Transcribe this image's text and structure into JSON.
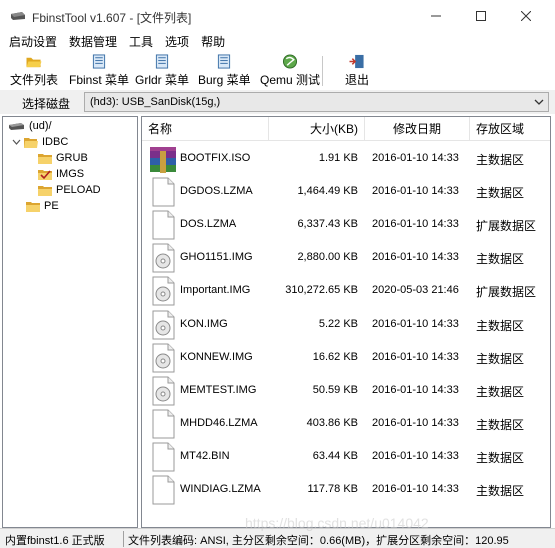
{
  "window": {
    "title": "FbinstTool v1.607 - [文件列表]"
  },
  "menu": [
    "启动设置",
    "数据管理",
    "工具",
    "选项",
    "帮助"
  ],
  "toolbar": {
    "buttons": [
      {
        "label": "文件列表",
        "icon": "folder-open-icon"
      },
      {
        "label": "Fbinst 菜单",
        "icon": "menu-doc-icon"
      },
      {
        "label": "Grldr 菜单",
        "icon": "menu-doc-icon"
      },
      {
        "label": "Burg 菜单",
        "icon": "menu-doc-icon"
      },
      {
        "label": "Qemu 测试",
        "icon": "qemu-globe-icon"
      },
      {
        "label": "退出",
        "icon": "exit-door-icon"
      }
    ]
  },
  "disk": {
    "label": "选择磁盘",
    "value": "(hd3): USB_SanDisk(15g,)"
  },
  "tree": {
    "root": "(ud)/",
    "nodes": [
      {
        "label": "IDBC"
      },
      {
        "label": "GRUB"
      },
      {
        "label": "IMGS"
      },
      {
        "label": "PELOAD"
      },
      {
        "label": "PE"
      }
    ]
  },
  "columns": {
    "name": "名称",
    "size": "大小(KB)",
    "date": "修改日期",
    "area": "存放区域"
  },
  "files": [
    {
      "name": "BOOTFIX.ISO",
      "size": "1.91 KB",
      "date": "2016-01-10 14:33",
      "area": "主数据区",
      "icon": "archive-icon"
    },
    {
      "name": "DGDOS.LZMA",
      "size": "1,464.49 KB",
      "date": "2016-01-10 14:33",
      "area": "主数据区",
      "icon": "blank-file-icon"
    },
    {
      "name": "DOS.LZMA",
      "size": "6,337.43 KB",
      "date": "2016-01-10 14:33",
      "area": "扩展数据区",
      "icon": "blank-file-icon"
    },
    {
      "name": "GHO1151.IMG",
      "size": "2,880.00 KB",
      "date": "2016-01-10 14:33",
      "area": "主数据区",
      "icon": "disk-image-icon"
    },
    {
      "name": "Important.IMG",
      "size": "310,272.65 KB",
      "date": "2020-05-03 21:46",
      "area": "扩展数据区",
      "icon": "disk-image-icon"
    },
    {
      "name": "KON.IMG",
      "size": "5.22 KB",
      "date": "2016-01-10 14:33",
      "area": "主数据区",
      "icon": "disk-image-icon"
    },
    {
      "name": "KONNEW.IMG",
      "size": "16.62 KB",
      "date": "2016-01-10 14:33",
      "area": "主数据区",
      "icon": "disk-image-icon"
    },
    {
      "name": "MEMTEST.IMG",
      "size": "50.59 KB",
      "date": "2016-01-10 14:33",
      "area": "主数据区",
      "icon": "disk-image-icon"
    },
    {
      "name": "MHDD46.LZMA",
      "size": "403.86 KB",
      "date": "2016-01-10 14:33",
      "area": "主数据区",
      "icon": "blank-file-icon"
    },
    {
      "name": "MT42.BIN",
      "size": "63.44 KB",
      "date": "2016-01-10 14:33",
      "area": "主数据区",
      "icon": "blank-file-icon"
    },
    {
      "name": "WINDIAG.LZMA",
      "size": "117.78 KB",
      "date": "2016-01-10 14:33",
      "area": "主数据区",
      "icon": "blank-file-icon"
    }
  ],
  "status": {
    "left": "内置fbinst1.6 正式版",
    "right": "文件列表编码: ANSI, 主分区剩余空间：0.66(MB)，扩展分区剩余空间：120.95"
  },
  "watermark": "https://blog.csdn.net/u014042"
}
